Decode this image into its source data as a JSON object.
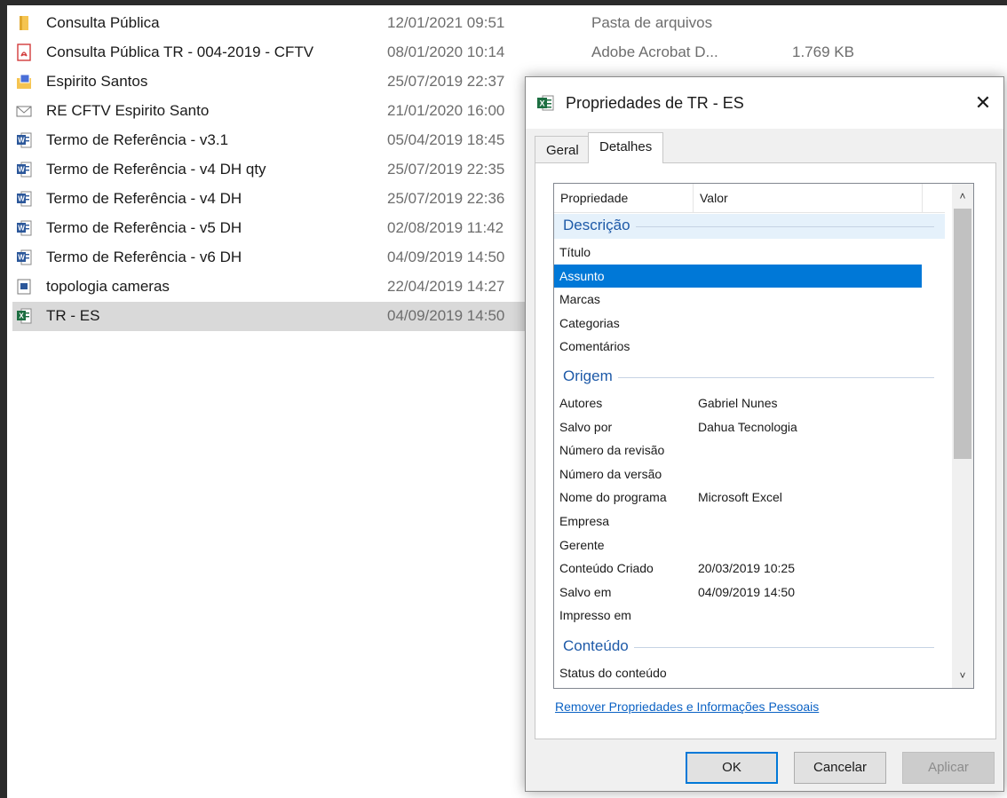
{
  "explorer": {
    "files": [
      {
        "name": "Consulta Pública",
        "date": "12/01/2021 09:51",
        "type": "Pasta de arquivos",
        "size": "",
        "icon": "folder-icon",
        "selected": false
      },
      {
        "name": "Consulta Pública TR - 004-2019 - CFTV",
        "date": "08/01/2020 10:14",
        "type": "Adobe Acrobat D...",
        "size": "1.769 KB",
        "icon": "pdf-icon",
        "selected": false
      },
      {
        "name": "Espirito Santos",
        "date": "25/07/2019 22:37",
        "type": "",
        "size": "",
        "icon": "image-folder-icon",
        "selected": false
      },
      {
        "name": "RE  CFTV Espirito Santo",
        "date": "21/01/2020 16:00",
        "type": "",
        "size": "",
        "icon": "email-icon",
        "selected": false
      },
      {
        "name": "Termo de Referência - v3.1",
        "date": "05/04/2019 18:45",
        "type": "",
        "size": "",
        "icon": "word-doc-icon",
        "selected": false
      },
      {
        "name": "Termo de Referência - v4 DH qty",
        "date": "25/07/2019 22:35",
        "type": "",
        "size": "",
        "icon": "word-doc-icon",
        "selected": false
      },
      {
        "name": "Termo de Referência - v4 DH",
        "date": "25/07/2019 22:36",
        "type": "",
        "size": "",
        "icon": "word-doc-icon",
        "selected": false
      },
      {
        "name": "Termo de Referência - v5 DH",
        "date": "02/08/2019 11:42",
        "type": "",
        "size": "",
        "icon": "word-doc-icon",
        "selected": false
      },
      {
        "name": "Termo de Referência - v6 DH",
        "date": "04/09/2019 14:50",
        "type": "",
        "size": "",
        "icon": "word-doc-icon",
        "selected": false
      },
      {
        "name": "topologia cameras",
        "date": "22/04/2019 14:27",
        "type": "",
        "size": "",
        "icon": "visio-doc-icon",
        "selected": false
      },
      {
        "name": "TR - ES",
        "date": "04/09/2019 14:50",
        "type": "",
        "size": "",
        "icon": "excel-doc-icon",
        "selected": true
      }
    ]
  },
  "dialog": {
    "title": "Propriedades de TR - ES",
    "close_label": "✕",
    "tabs": [
      "Geral",
      "Detalhes"
    ],
    "active_tab": "Detalhes",
    "columns": {
      "property": "Propriedade",
      "value": "Valor"
    },
    "groups": {
      "descricao": "Descrição",
      "origem": "Origem",
      "conteudo": "Conteúdo"
    },
    "descricao_props": [
      {
        "name": "Título",
        "value": ""
      },
      {
        "name": "Assunto",
        "value": "",
        "selected": true
      },
      {
        "name": "Marcas",
        "value": ""
      },
      {
        "name": "Categorias",
        "value": ""
      },
      {
        "name": "Comentários",
        "value": ""
      }
    ],
    "origem_props": [
      {
        "name": "Autores",
        "value": "Gabriel Nunes"
      },
      {
        "name": "Salvo por",
        "value": "Dahua Tecnologia"
      },
      {
        "name": "Número da revisão",
        "value": ""
      },
      {
        "name": "Número da versão",
        "value": ""
      },
      {
        "name": "Nome do programa",
        "value": "Microsoft Excel"
      },
      {
        "name": "Empresa",
        "value": ""
      },
      {
        "name": "Gerente",
        "value": ""
      },
      {
        "name": "Conteúdo Criado",
        "value": "20/03/2019 10:25"
      },
      {
        "name": "Salvo em",
        "value": "04/09/2019 14:50"
      },
      {
        "name": "Impresso em",
        "value": ""
      }
    ],
    "conteudo_props": [
      {
        "name": "Status do conteúdo",
        "value": ""
      }
    ],
    "remove_link": "Remover Propriedades e Informações Pessoais",
    "buttons": {
      "ok": "OK",
      "cancel": "Cancelar",
      "apply": "Aplicar"
    },
    "accent_color": "#0078d7"
  }
}
